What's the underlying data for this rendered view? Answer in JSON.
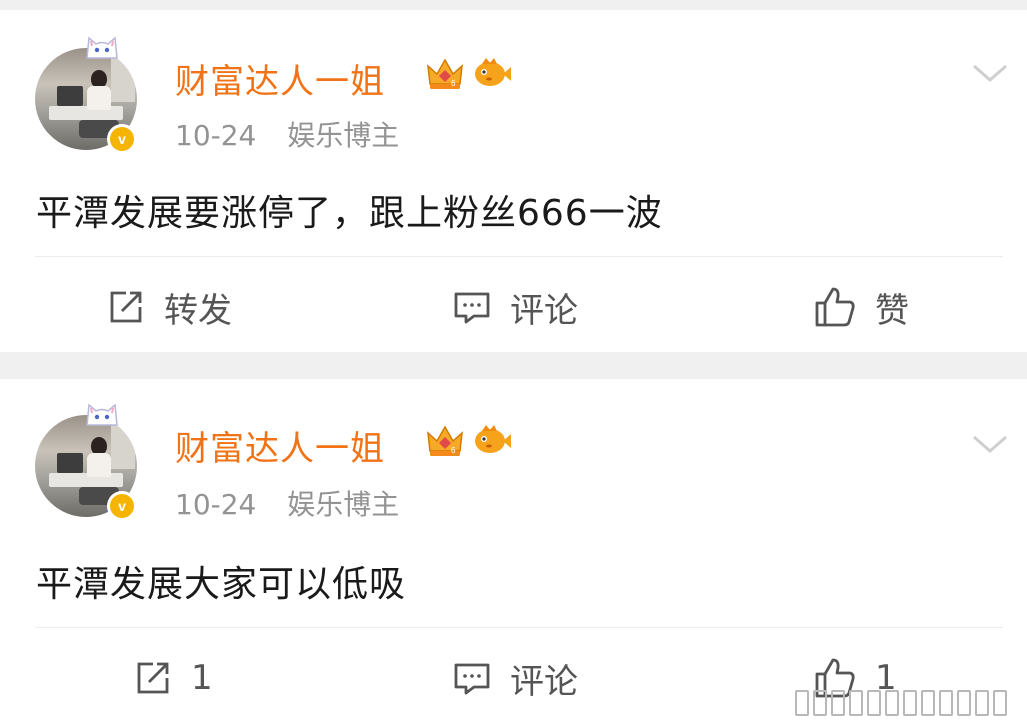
{
  "posts": [
    {
      "username": "财富达人一姐",
      "date": "10-24",
      "tag": "娱乐博主",
      "content": "平潭发展要涨停了，跟上粉丝666一波",
      "share_label": "转发",
      "comment_label": "评论",
      "like_label": "赞"
    },
    {
      "username": "财富达人一姐",
      "date": "10-24",
      "tag": "娱乐博主",
      "content": "平潭发展大家可以低吸",
      "share_label": "1",
      "comment_label": "评论",
      "like_label": "1"
    }
  ],
  "colors": {
    "username": "#f27316",
    "verify": "#f5b400",
    "meta": "#939393",
    "text": "#1a1a1a",
    "action": "#555555",
    "background": "#f0f0f0"
  },
  "icons": {
    "share": "share-icon",
    "comment": "comment-icon",
    "like": "thumbs-up-icon",
    "menu": "chevron-down-icon",
    "verify": "verified-v-icon",
    "crown": "crown-badge-icon",
    "fish": "fish-badge-icon",
    "cat": "cat-avatar-frame-icon"
  }
}
